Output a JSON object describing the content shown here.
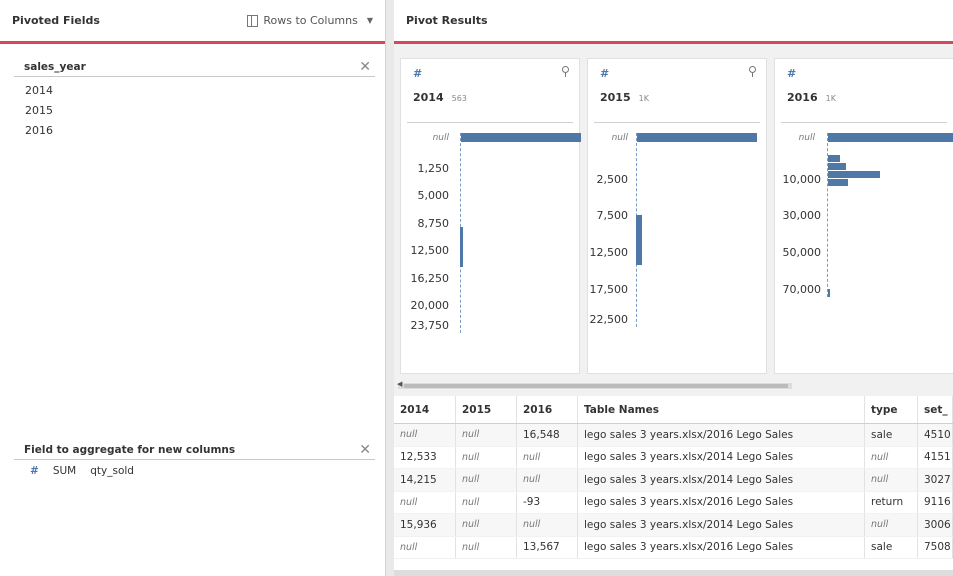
{
  "left": {
    "title": "Pivoted Fields",
    "rows_to_columns": "Rows to Columns",
    "pivot_field": {
      "name": "sales_year",
      "values": [
        "2014",
        "2015",
        "2016"
      ]
    },
    "aggregate": {
      "title": "Field to aggregate for new columns",
      "hash": "#",
      "func": "SUM",
      "field": "qty_sold"
    }
  },
  "right": {
    "title": "Pivot Results",
    "cards": [
      {
        "hash": "#",
        "name": "2014",
        "count": "563",
        "ticks": [
          "null",
          "1,250",
          "5,000",
          "8,750",
          "12,500",
          "16,250",
          "20,000",
          "23,750"
        ]
      },
      {
        "hash": "#",
        "name": "2015",
        "count": "1K",
        "ticks": [
          "null",
          "2,500",
          "7,500",
          "12,500",
          "17,500",
          "22,500"
        ]
      },
      {
        "hash": "#",
        "name": "2016",
        "count": "1K",
        "ticks": [
          "null",
          "10,000",
          "30,000",
          "50,000",
          "70,000"
        ]
      }
    ],
    "table": {
      "columns": [
        "2014",
        "2015",
        "2016",
        "Table Names",
        "type",
        "set_"
      ],
      "rows": [
        [
          "null",
          "null",
          "16,548",
          "lego sales 3 years.xlsx/2016 Lego Sales",
          "sale",
          "4510"
        ],
        [
          "12,533",
          "null",
          "null",
          "lego sales 3 years.xlsx/2014 Lego Sales",
          "null",
          "4151"
        ],
        [
          "14,215",
          "null",
          "null",
          "lego sales 3 years.xlsx/2014 Lego Sales",
          "null",
          "3027"
        ],
        [
          "null",
          "null",
          "-93",
          "lego sales 3 years.xlsx/2016 Lego Sales",
          "return",
          "9116"
        ],
        [
          "15,936",
          "null",
          "null",
          "lego sales 3 years.xlsx/2014 Lego Sales",
          "null",
          "3006"
        ],
        [
          "null",
          "null",
          "13,567",
          "lego sales 3 years.xlsx/2016 Lego Sales",
          "sale",
          "7508"
        ]
      ]
    }
  },
  "colors": {
    "accent": "#d4475f",
    "bar": "#4e79a7"
  }
}
